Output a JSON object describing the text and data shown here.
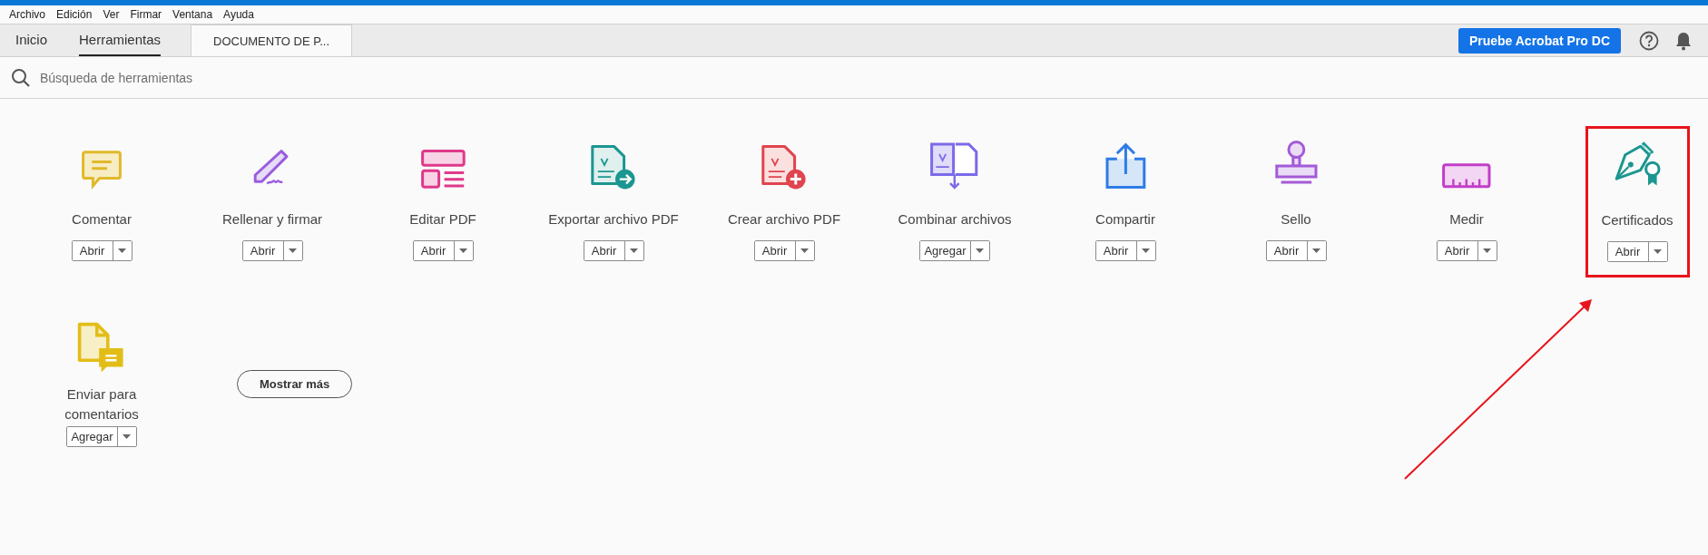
{
  "menu": [
    "Archivo",
    "Edición",
    "Ver",
    "Firmar",
    "Ventana",
    "Ayuda"
  ],
  "tabs": [
    {
      "label": "Inicio",
      "kind": "nav",
      "selected": false
    },
    {
      "label": "Herramientas",
      "kind": "nav",
      "selected": true
    },
    {
      "label": "DOCUMENTO DE P...",
      "kind": "document",
      "selected": false
    }
  ],
  "trial_button": "Pruebe Acrobat Pro DC",
  "search": {
    "placeholder": "Búsqueda de herramientas"
  },
  "tools": [
    {
      "label": "Comentar",
      "action": "Abrir",
      "highlighted": false
    },
    {
      "label": "Rellenar y firmar",
      "action": "Abrir",
      "highlighted": false
    },
    {
      "label": "Editar PDF",
      "action": "Abrir",
      "highlighted": false
    },
    {
      "label": "Exportar archivo PDF",
      "action": "Abrir",
      "highlighted": false
    },
    {
      "label": "Crear archivo PDF",
      "action": "Abrir",
      "highlighted": false
    },
    {
      "label": "Combinar archivos",
      "action": "Agregar",
      "highlighted": false
    },
    {
      "label": "Compartir",
      "action": "Abrir",
      "highlighted": false
    },
    {
      "label": "Sello",
      "action": "Abrir",
      "highlighted": false
    },
    {
      "label": "Medir",
      "action": "Abrir",
      "highlighted": false
    },
    {
      "label": "Certificados",
      "action": "Abrir",
      "highlighted": true
    },
    {
      "label": "Enviar para comentarios",
      "action": "Agregar",
      "highlighted": false
    }
  ],
  "show_more": "Mostrar más"
}
